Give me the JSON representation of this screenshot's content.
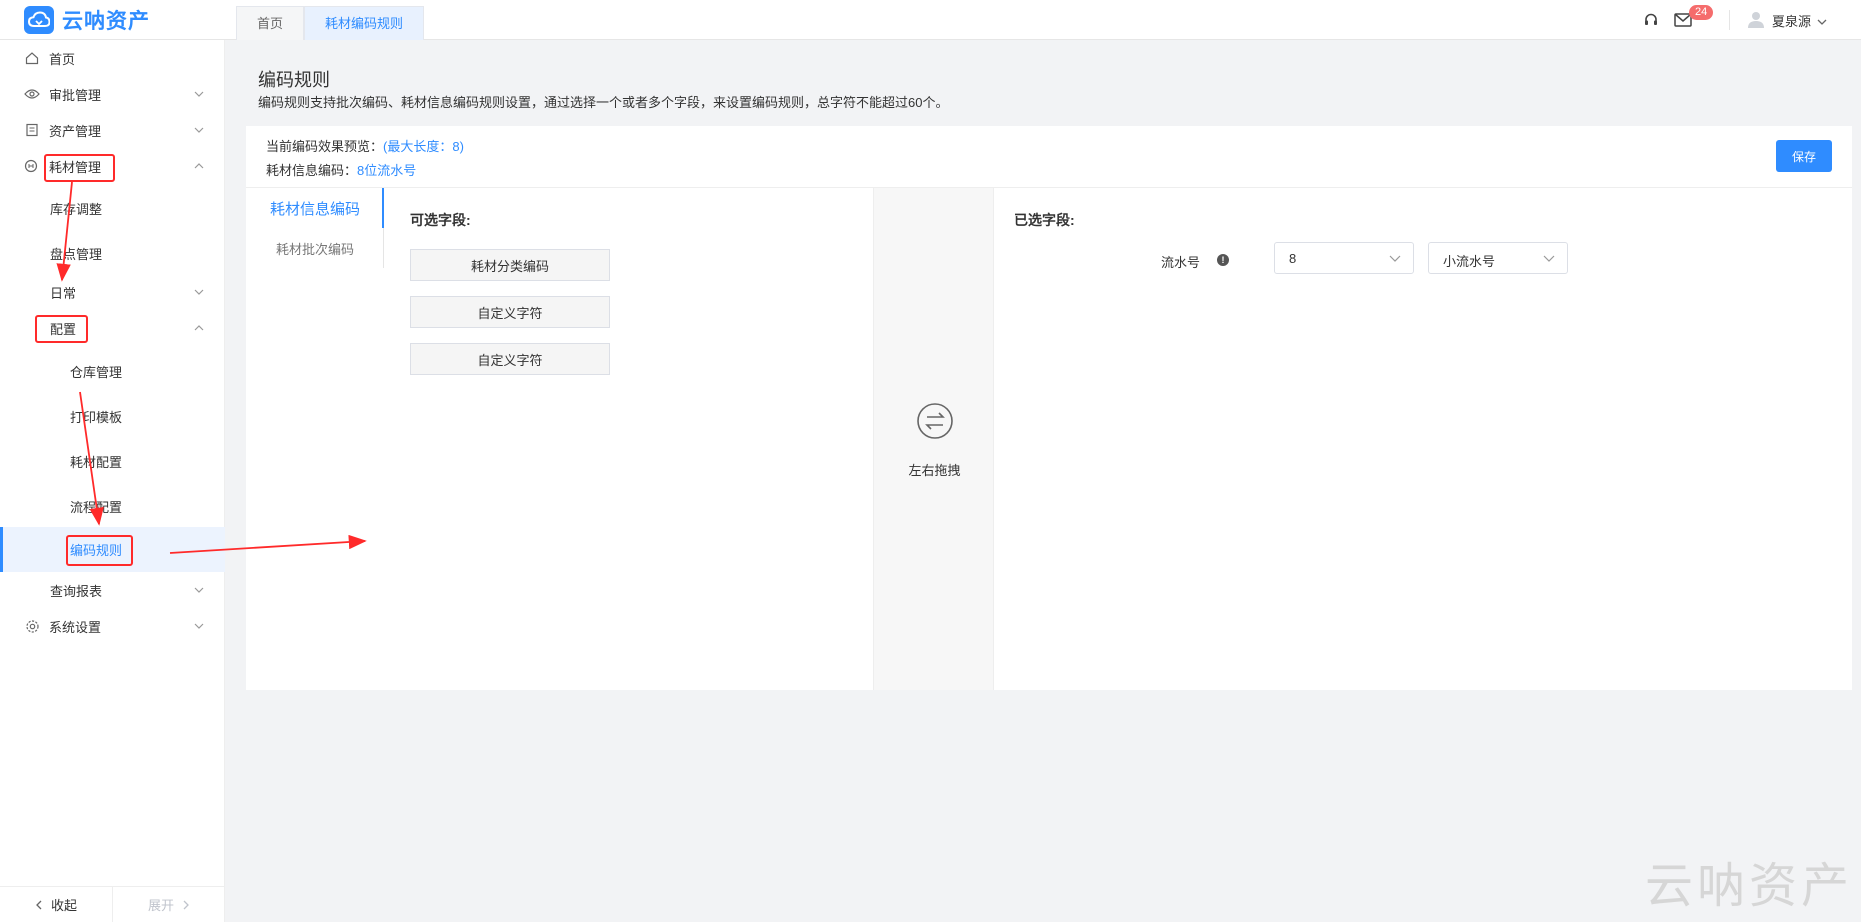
{
  "app": {
    "name": "云呐资产"
  },
  "tabs": [
    {
      "label": "首页",
      "active": false
    },
    {
      "label": "耗材编码规则",
      "active": true
    }
  ],
  "header": {
    "notification_count": "24",
    "user_name": "夏泉源"
  },
  "sidebar": {
    "items": [
      {
        "label": "首页"
      },
      {
        "label": "审批管理"
      },
      {
        "label": "资产管理"
      },
      {
        "label": "耗材管理"
      },
      {
        "label": "库存调整"
      },
      {
        "label": "盘点管理"
      },
      {
        "label": "日常"
      },
      {
        "label": "配置"
      },
      {
        "label": "仓库管理"
      },
      {
        "label": "打印模板"
      },
      {
        "label": "耗材配置"
      },
      {
        "label": "流程配置"
      },
      {
        "label": "编码规则"
      },
      {
        "label": "查询报表"
      },
      {
        "label": "系统设置"
      }
    ],
    "collapse_label": "收起",
    "expand_label": "展开"
  },
  "page": {
    "title": "编码规则",
    "description": "编码规则支持批次编码、耗材信息编码规则设置，通过选择一个或者多个字段，来设置编码规则，总字符不能超过60个。",
    "preview_label": "当前编码效果预览：",
    "preview_max": "(最大长度：8)",
    "info_code_label": "耗材信息编码：",
    "info_code_value": "8位流水号",
    "save_label": "保存"
  },
  "rule_tabs": [
    {
      "label": "耗材信息编码",
      "active": true
    },
    {
      "label": "耗材批次编码",
      "active": false
    }
  ],
  "available": {
    "title": "可选字段:",
    "fields": [
      "耗材分类编码",
      "自定义字符",
      "自定义字符"
    ]
  },
  "drag": {
    "label": "左右拖拽"
  },
  "selected": {
    "title": "已选字段:",
    "field_label": "流水号",
    "length_value": "8",
    "type_value": "小流水号"
  },
  "watermark": "云呐资产",
  "colors": {
    "accent": "#2f8cff",
    "annotation": "#ff2a2a",
    "badge": "#f56c6c"
  }
}
